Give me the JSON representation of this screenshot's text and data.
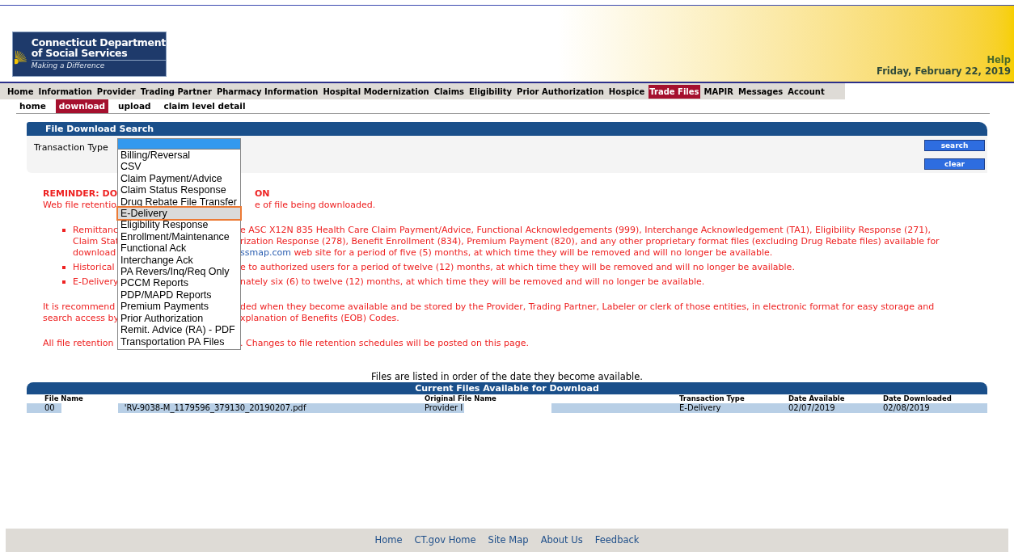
{
  "header": {
    "logo": {
      "title_lines": [
        "Connecticut Department",
        "of Social Services"
      ],
      "tagline": "Making a Difference"
    },
    "help_link": "Help",
    "date": "Friday, February 22, 2019"
  },
  "nav": [
    {
      "label": "Home",
      "selected": false
    },
    {
      "label": "Information",
      "selected": false
    },
    {
      "label": "Provider",
      "selected": false
    },
    {
      "label": "Trading Partner",
      "selected": false
    },
    {
      "label": "Pharmacy Information",
      "selected": false
    },
    {
      "label": "Hospital Modernization",
      "selected": false
    },
    {
      "label": "Claims",
      "selected": false
    },
    {
      "label": "Eligibility",
      "selected": false
    },
    {
      "label": "Prior Authorization",
      "selected": false
    },
    {
      "label": "Hospice",
      "selected": false
    },
    {
      "label": "Trade Files",
      "selected": true
    },
    {
      "label": "MAPIR",
      "selected": false
    },
    {
      "label": "Messages",
      "selected": false
    },
    {
      "label": "Account",
      "selected": false
    }
  ],
  "subnav": [
    {
      "label": "home",
      "selected": false
    },
    {
      "label": "download",
      "selected": true
    },
    {
      "label": "upload",
      "selected": false
    },
    {
      "label": "claim level detail",
      "selected": false
    }
  ],
  "search_panel": {
    "title": "File Download Search",
    "field_label": "Transaction Type",
    "dropdown": {
      "expanded": true,
      "options": [
        {
          "label": "Billing/Reversal",
          "selected": false
        },
        {
          "label": "CSV",
          "selected": false
        },
        {
          "label": "Claim Payment/Advice",
          "selected": false
        },
        {
          "label": "Claim Status Response",
          "selected": false
        },
        {
          "label": "Drug Rebate File Transfer",
          "selected": false
        },
        {
          "label": "E-Delivery",
          "selected": true
        },
        {
          "label": "Eligibility Response",
          "selected": false
        },
        {
          "label": "Enrollment/Maintenance",
          "selected": false
        },
        {
          "label": "Functional Ack",
          "selected": false
        },
        {
          "label": "Interchange Ack",
          "selected": false
        },
        {
          "label": "PA Revers/Inq/Req Only",
          "selected": false
        },
        {
          "label": "PCCM Reports",
          "selected": false
        },
        {
          "label": "PDP/MAPD Reports",
          "selected": false
        },
        {
          "label": "Premium Payments",
          "selected": false
        },
        {
          "label": "Prior Authorization",
          "selected": false
        },
        {
          "label": "Remit. Advice (RA) - PDF",
          "selected": false
        },
        {
          "label": "Transportation PA Files",
          "selected": false
        }
      ]
    },
    "buttons": [
      "search",
      "clear"
    ]
  },
  "notice": [
    {
      "kind": "paragraph",
      "lines": [
        {
          "left": "REMINDER: DO",
          "right": "ON",
          "bold": true
        },
        {
          "left": "Web file retentio",
          "right": "e of file being downloaded.",
          "bold": false
        }
      ]
    },
    {
      "kind": "bullets",
      "items": [
        {
          "lines": [
            {
              "left": "Remittanc",
              "right": "e ASC X12N 835 Health Care Claim Payment/Advice, Functional Acknowledgements (999), Interchange Acknowledgement (TA1), Eligibility Response (271),"
            },
            {
              "left": "Claim Stat",
              "right": "rization Response (278), Benefit Enrollment (834), Premium Payment (820), and any other proprietary format files (excluding Drug Rebate files) available for"
            },
            {
              "left": "download",
              "link": "ssmap.com",
              "right": " web site for a period of five (5) months, at which time they will be removed and will no longer be available."
            }
          ]
        },
        {
          "lines": [
            {
              "left": "Historical",
              "right": "e to authorized users for a period of twelve (12) months, at which time they will be removed and will no longer be available."
            }
          ]
        },
        {
          "lines": [
            {
              "left": "E-Delivery",
              "right": "nately six (6) to twelve (12) months, at which time they will be removed and will no longer be available."
            }
          ]
        }
      ]
    },
    {
      "kind": "paragraph",
      "lines": [
        {
          "left": "It is recommend",
          "right": "ded when they become available and be stored by the Provider, Trading Partner, Labeler or clerk of those entities, in electronic format for easy storage and"
        },
        {
          "left": "search access by",
          "right": "xplanation of Benefits (EOB) Codes."
        }
      ]
    },
    {
      "kind": "paragraph",
      "lines": [
        {
          "left": "All file retention",
          "right": ". Changes to file retention schedules will be posted on this page."
        }
      ]
    }
  ],
  "files_table": {
    "caption": "Files are listed in order of the date they become available.",
    "title": "Current Files Available for Download",
    "columns": [
      "File Name",
      "Original File Name",
      "Transaction Type",
      "Date Available",
      "Date Downloaded"
    ],
    "rows": [
      {
        "cells": [
          [
            {
              "kind": "text",
              "text": "00"
            },
            {
              "kind": "redaction"
            },
            {
              "kind": "text",
              "text": "'RV-9038-M_1179596_379130_20190207.pdf"
            }
          ],
          [
            {
              "kind": "text",
              "text": "Provider I"
            },
            {
              "kind": "redaction"
            }
          ],
          [
            {
              "kind": "text",
              "text": "E-Delivery"
            }
          ],
          [
            {
              "kind": "text",
              "text": "02/07/2019"
            }
          ],
          [
            {
              "kind": "text",
              "text": "02/08/2019"
            }
          ]
        ]
      }
    ]
  },
  "footer_links": [
    "Home",
    "CT.gov Home",
    "Site Map",
    "About Us",
    "Feedback"
  ]
}
